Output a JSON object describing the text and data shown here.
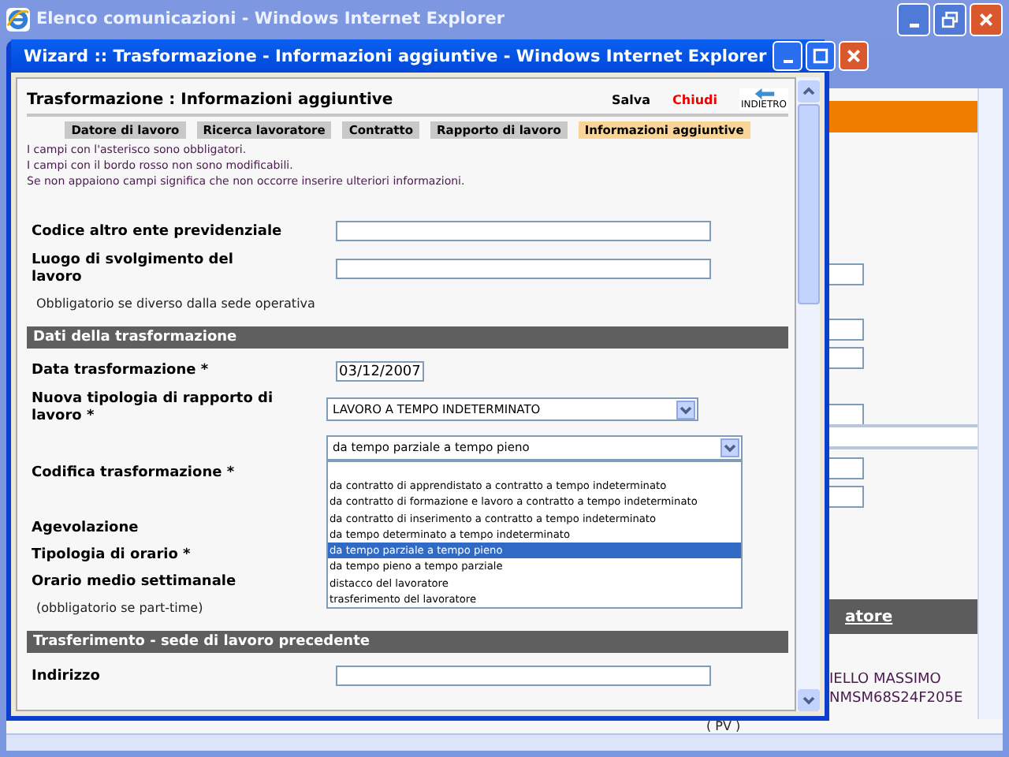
{
  "background_window": {
    "title": "Elenco comunicazioni - Windows Internet Explorer",
    "header_link": "atore",
    "worker_name": "IELLO MASSIMO",
    "worker_code": "NMSM68S24F205E",
    "province": "( PV )"
  },
  "popup": {
    "title": "Wizard :: Trasformazione - Informazioni aggiuntive - Windows Internet Explorer"
  },
  "page": {
    "heading": "Trasformazione : Informazioni aggiuntive",
    "actions": [
      {
        "label": "Salva",
        "kind": "save"
      },
      {
        "label": "Chiudi",
        "kind": "close"
      }
    ],
    "back_button": "INDIETRO"
  },
  "steps": [
    {
      "label": "Datore di lavoro",
      "selected": false
    },
    {
      "label": "Ricerca lavoratore",
      "selected": false
    },
    {
      "label": "Contratto",
      "selected": false
    },
    {
      "label": "Rapporto di lavoro",
      "selected": false
    },
    {
      "label": "Informazioni aggiuntive",
      "selected": true
    }
  ],
  "notes": [
    "I campi con l'asterisco sono obbligatori.",
    "I campi con il bordo rosso non sono modificabili.",
    "Se non appaiono campi significa che non occorre inserire ulteriori informazioni."
  ],
  "form": [
    {
      "kind": "text",
      "label": "Codice altro ente previdenziale"
    },
    {
      "kind": "text",
      "label": "Luogo di svolgimento del lavoro"
    },
    {
      "kind": "hint",
      "label": "Obbligatorio se diverso dalla sede operativa"
    },
    {
      "kind": "section",
      "label": "Dati della trasformazione"
    },
    {
      "kind": "date",
      "label": "Data trasformazione *",
      "value": "03/12/2007"
    },
    {
      "kind": "select",
      "label": "Nuova tipologia di rapporto di lavoro *",
      "value": "LAVORO A TEMPO INDETERMINATO",
      "open": false
    },
    {
      "kind": "select",
      "label": "Codifica trasformazione *",
      "value": "da tempo parziale a tempo pieno",
      "open": true,
      "options": [
        {
          "label": "da contratto di apprendistato a contratto a tempo indeterminato",
          "selected": false
        },
        {
          "label": "da contratto di formazione e lavoro a contratto a tempo indeterminato",
          "selected": false
        },
        {
          "label": "da contratto di inserimento a contratto a tempo indeterminato",
          "selected": false
        },
        {
          "label": "da tempo determinato a tempo indeterminato",
          "selected": false
        },
        {
          "label": "da tempo parziale a tempo pieno",
          "selected": true
        },
        {
          "label": "da tempo pieno a tempo parziale",
          "selected": false
        },
        {
          "label": "distacco del lavoratore",
          "selected": false
        },
        {
          "label": "trasferimento del lavoratore",
          "selected": false
        }
      ]
    },
    {
      "kind": "plain",
      "label": "Agevolazione"
    },
    {
      "kind": "plain",
      "label": "Tipologia di orario *"
    },
    {
      "kind": "plain",
      "label": "Orario medio settimanale"
    },
    {
      "kind": "hint",
      "label": "(obbligatorio se part-time)"
    },
    {
      "kind": "section",
      "label": "Trasferimento - sede di lavoro precedente"
    },
    {
      "kind": "text",
      "label": "Indirizzo"
    }
  ]
}
